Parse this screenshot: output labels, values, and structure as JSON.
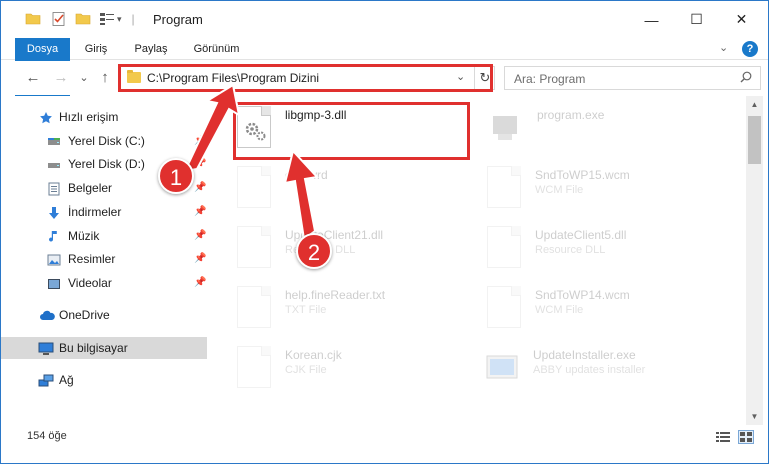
{
  "window": {
    "title": "Program",
    "minimize": "—",
    "maximize": "☐",
    "close": "✕"
  },
  "ribbon": {
    "tabs": [
      "Dosya",
      "Giriş",
      "Paylaş",
      "Görünüm"
    ],
    "help": "?"
  },
  "nav": {
    "back": "←",
    "forward": "→",
    "recent": "⌄",
    "up": "↑",
    "address": "C:\\Program Files\\Program Dizini",
    "search_placeholder": "Ara: Program"
  },
  "sidebar": {
    "items": [
      {
        "label": "Hızlı erişim",
        "icon": "star-icon",
        "pinned": false
      },
      {
        "label": "Yerel Disk (C:)",
        "icon": "drive-icon",
        "pinned": true
      },
      {
        "label": "Yerel Disk (D:)",
        "icon": "drive-icon",
        "pinned": true
      },
      {
        "label": "Belgeler",
        "icon": "documents-icon",
        "pinned": true
      },
      {
        "label": "İndirmeler",
        "icon": "download-icon",
        "pinned": true
      },
      {
        "label": "Müzik",
        "icon": "music-icon",
        "pinned": true
      },
      {
        "label": "Resimler",
        "icon": "pictures-icon",
        "pinned": true
      },
      {
        "label": "Videolar",
        "icon": "videos-icon",
        "pinned": true
      },
      {
        "label": "OneDrive",
        "icon": "cloud-icon",
        "pinned": false
      },
      {
        "label": "Bu bilgisayar",
        "icon": "computer-icon",
        "pinned": false
      },
      {
        "label": "Ağ",
        "icon": "network-icon",
        "pinned": false
      }
    ]
  },
  "files": [
    {
      "name": "libgmp-3.dll",
      "type": "",
      "icon": "dll-file-icon",
      "highlighted": true
    },
    {
      "name": "program.exe",
      "type": "",
      "icon": "exe-file-icon",
      "highlighted": false
    },
    {
      "name": "ded.wrd",
      "type": "",
      "icon": "document-file-icon",
      "highlighted": false
    },
    {
      "name": "SndToWP15.wcm",
      "type": "WCM File",
      "icon": "document-file-icon",
      "highlighted": false
    },
    {
      "name": "UpdateClient21.dll",
      "type": "Resource DLL",
      "icon": "dll-file-icon",
      "highlighted": false
    },
    {
      "name": "UpdateClient5.dll",
      "type": "Resource DLL",
      "icon": "dll-file-icon",
      "highlighted": false
    },
    {
      "name": "help.fineReader.txt",
      "type": "TXT File",
      "icon": "document-file-icon",
      "highlighted": false
    },
    {
      "name": "SndToWP14.wcm",
      "type": "WCM File",
      "icon": "document-file-icon",
      "highlighted": false
    },
    {
      "name": "Korean.cjk",
      "type": "CJK File",
      "icon": "document-file-icon",
      "highlighted": false
    },
    {
      "name": "UpdateInstaller.exe",
      "type": "ABBY updates installer",
      "icon": "exe-file-icon",
      "highlighted": false
    }
  ],
  "status": {
    "count": "154 öğe"
  },
  "annotations": {
    "step1": "1",
    "step2": "2",
    "color": "#e0302e"
  }
}
